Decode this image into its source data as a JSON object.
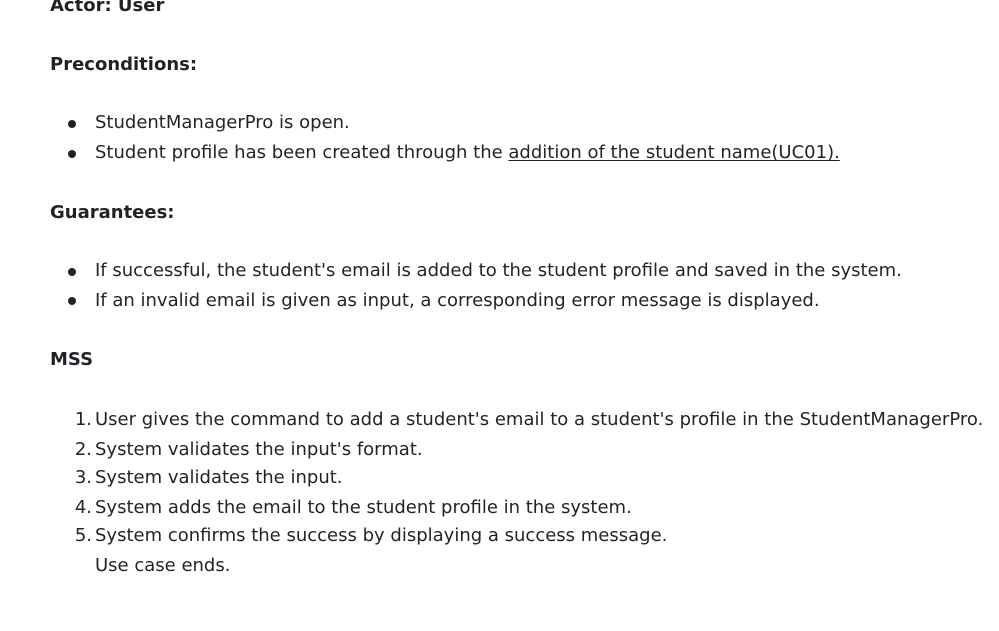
{
  "actor": "Actor: User",
  "preconditions": {
    "heading": "Preconditions:",
    "items": [
      {
        "text": "StudentManagerPro is open."
      },
      {
        "text": "Student profile has been created through the ",
        "link": "addition of the student name(UC01)."
      }
    ]
  },
  "guarantees": {
    "heading": "Guarantees:",
    "items": [
      "If successful, the student's email is added to the student profile and saved in the system.",
      "If an invalid email is given as input, a corresponding error message is displayed."
    ]
  },
  "mss": {
    "heading": "MSS",
    "steps": [
      {
        "num": "1.",
        "text": "User gives the command to add a student's email to a student's profile in the StudentManagerPro."
      },
      {
        "num": "2.",
        "text": "System validates the input's format."
      },
      {
        "num": "3.",
        "text": "System validates the input."
      },
      {
        "num": "4.",
        "text": "System adds the email to the student profile in the system."
      },
      {
        "num": "5.",
        "text": "System confirms the success by displaying a success message."
      }
    ],
    "end_note": "Use case ends."
  }
}
